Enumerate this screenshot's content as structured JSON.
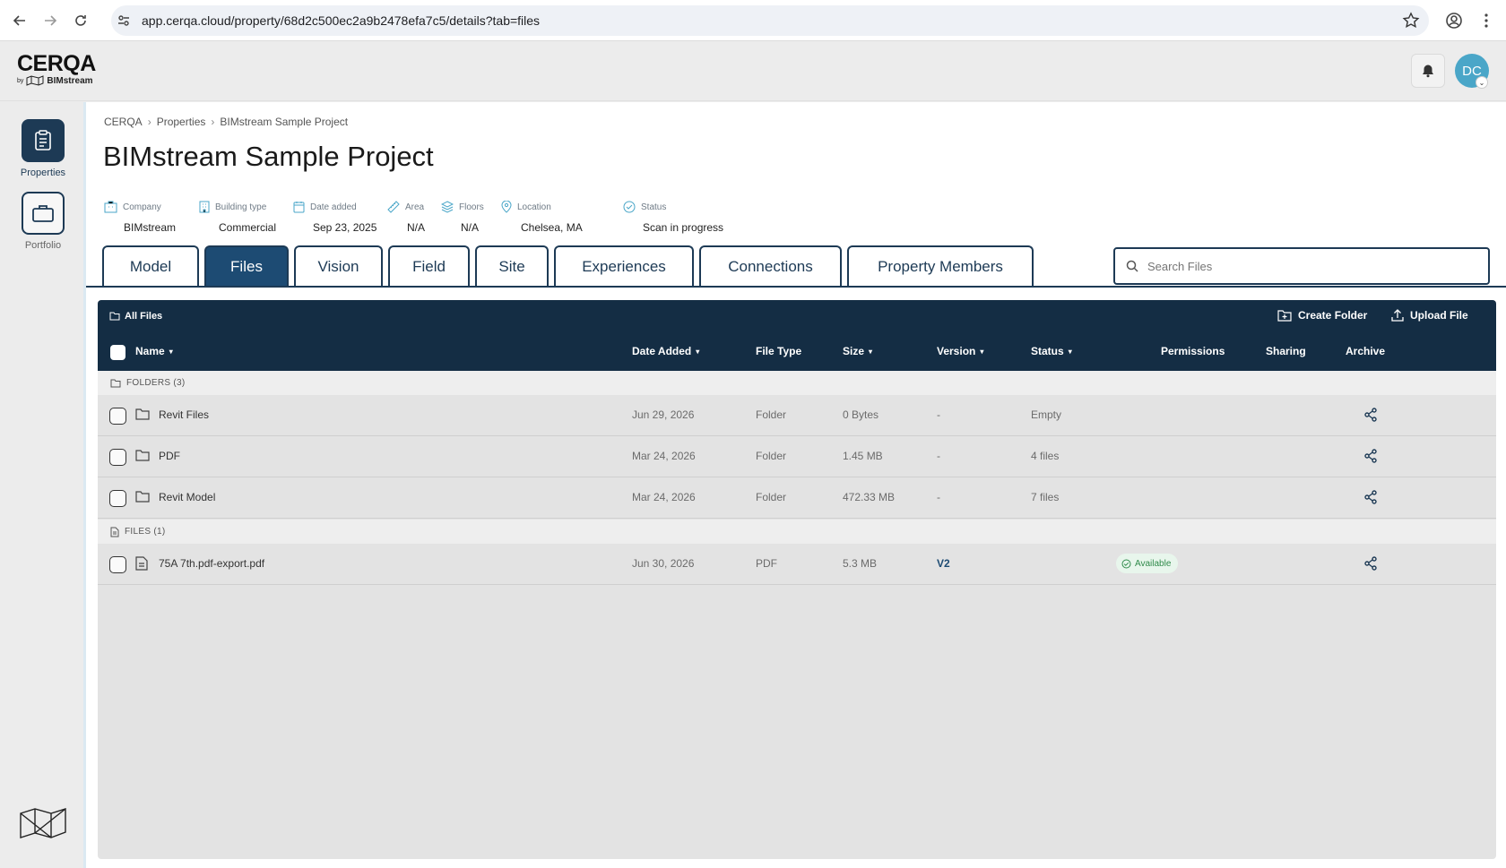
{
  "browser": {
    "url": "app.cerqa.cloud/property/68d2c500ec2a9b2478efa7c5/details?tab=files"
  },
  "brand": {
    "name": "CERQA",
    "by": "by",
    "partner": "BIMstream",
    "accent": "#1d3a55"
  },
  "user": {
    "initials": "DC",
    "avatar_color": "#4aa6c8"
  },
  "rail": {
    "items": [
      {
        "label": "Properties",
        "icon": "clipboard-icon",
        "active": true
      },
      {
        "label": "Portfolio",
        "icon": "briefcase-icon",
        "active": false
      }
    ]
  },
  "breadcrumb": [
    "CERQA",
    "Properties",
    "BIMstream Sample Project"
  ],
  "breadcrumb_sep": "›",
  "page_title": "BIMstream Sample Project",
  "meta": [
    {
      "label": "Company",
      "value": "BIMstream",
      "icon": "building-icon"
    },
    {
      "label": "Building type",
      "value": "Commercial",
      "icon": "office-icon"
    },
    {
      "label": "Date added",
      "value": "Sep 23, 2025",
      "icon": "calendar-icon"
    },
    {
      "label": "Area",
      "value": "N/A",
      "icon": "ruler-icon"
    },
    {
      "label": "Floors",
      "value": "N/A",
      "icon": "layers-icon"
    },
    {
      "label": "Location",
      "value": "Chelsea, MA",
      "icon": "pin-icon"
    },
    {
      "label": "Status",
      "value": "Scan in progress",
      "icon": "check-circle-icon"
    }
  ],
  "tabs": [
    {
      "label": "Model",
      "active": false
    },
    {
      "label": "Files",
      "active": true
    },
    {
      "label": "Vision",
      "active": false
    },
    {
      "label": "Field",
      "active": false
    },
    {
      "label": "Site",
      "active": false
    },
    {
      "label": "Experiences",
      "active": false
    },
    {
      "label": "Connections",
      "active": false
    },
    {
      "label": "Property Members",
      "active": false
    }
  ],
  "search": {
    "placeholder": "Search Files"
  },
  "files_panel": {
    "all_files": "All Files",
    "create_folder": "Create Folder",
    "upload_file": "Upload File",
    "columns": {
      "name": "Name",
      "date_added": "Date Added",
      "file_type": "File Type",
      "size": "Size",
      "version": "Version",
      "status": "Status",
      "permissions": "Permissions",
      "sharing": "Sharing",
      "archive": "Archive"
    },
    "folders_header": "FOLDERS (3)",
    "files_header": "FILES (1)",
    "folders": [
      {
        "name": "Revit Files",
        "date": "Jun 29, 2026",
        "type": "Folder",
        "size": "0 Bytes",
        "version": "-",
        "status": "Empty"
      },
      {
        "name": "PDF",
        "date": "Mar 24, 2026",
        "type": "Folder",
        "size": "1.45 MB",
        "version": "-",
        "status": "4 files"
      },
      {
        "name": "Revit Model",
        "date": "Mar 24, 2026",
        "type": "Folder",
        "size": "472.33 MB",
        "version": "-",
        "status": "7 files"
      }
    ],
    "files": [
      {
        "name": "75A 7th.pdf-export.pdf",
        "date": "Jun 30, 2026",
        "type": "PDF",
        "size": "5.3 MB",
        "version": "V2",
        "status": "Available",
        "status_color": "#2f8a4a"
      }
    ]
  }
}
